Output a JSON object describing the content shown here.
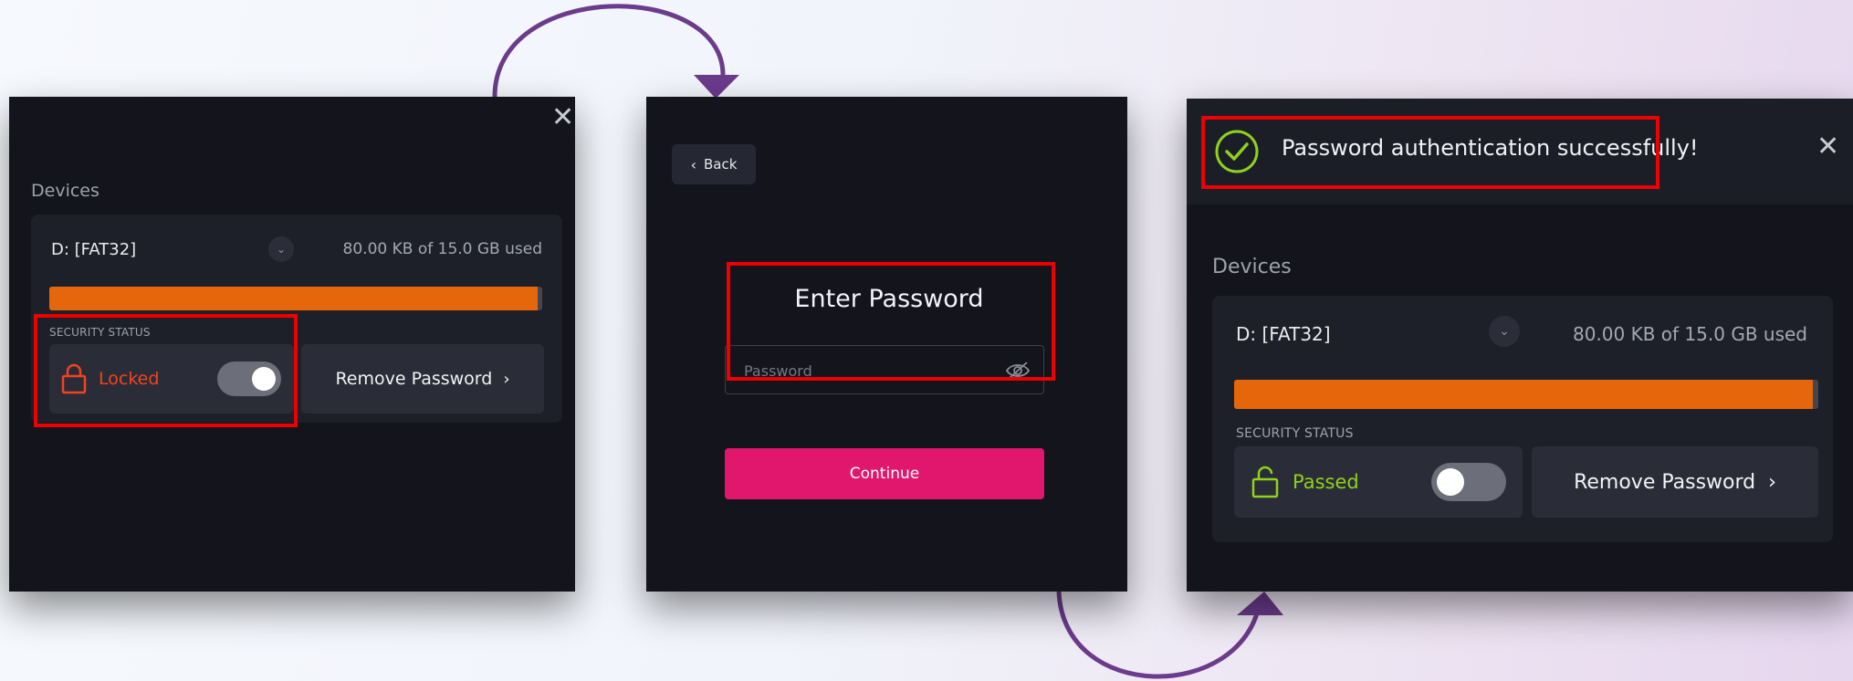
{
  "colors": {
    "accent": "#e0176d",
    "progress": "#e6660c",
    "locked": "#f0441e",
    "passed": "#8fd11d",
    "highlight": "#ec0000",
    "arrow": "#6b3b8c"
  },
  "panel1": {
    "devices_label": "Devices",
    "drive": "D: [FAT32]",
    "usage": "80.00 KB of 15.0 GB used",
    "usage_fraction": 0.99,
    "security_label": "SECURITY STATUS",
    "status": "Locked",
    "status_icon": "lock-icon",
    "toggle_on": true,
    "remove_label": "Remove Password"
  },
  "panel2": {
    "back_label": "Back",
    "title": "Enter Password",
    "password_placeholder": "Password",
    "continue_label": "Continue"
  },
  "panel3": {
    "toast": "Password authentication successfully!",
    "devices_label": "Devices",
    "drive": "D: [FAT32]",
    "usage": "80.00 KB of 15.0 GB used",
    "usage_fraction": 0.99,
    "security_label": "SECURITY STATUS",
    "status": "Passed",
    "status_icon": "unlock-icon",
    "toggle_on": false,
    "remove_label": "Remove Password"
  }
}
